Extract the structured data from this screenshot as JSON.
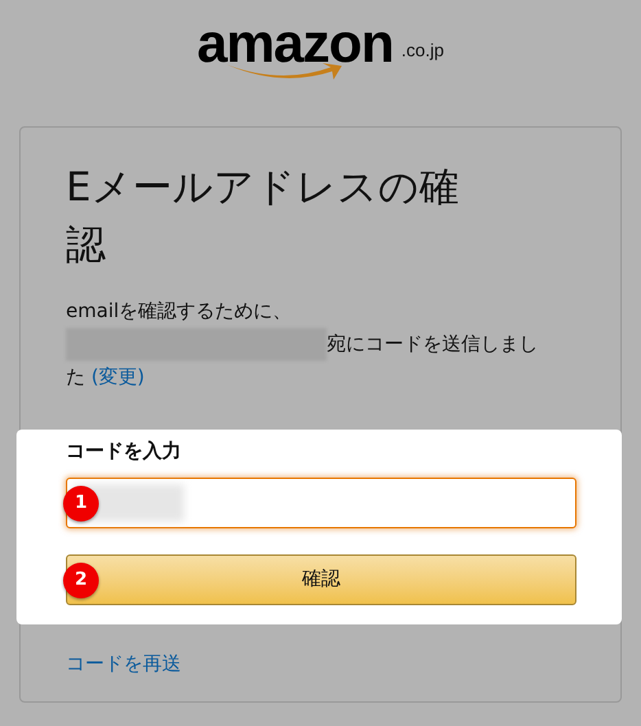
{
  "logo": {
    "wordmark": "amazon",
    "suffix": ".co.jp"
  },
  "title": "Eメールアドレスの確認",
  "message": {
    "before": "emailを確認するために、",
    "email_redacted": true,
    "after": "宛にコードを送信しました",
    "change_link": "(変更)"
  },
  "code_section": {
    "highlighted": true,
    "label": "コードを入力",
    "input": {
      "marker": "1",
      "focused": true,
      "value_redacted": true
    },
    "button": {
      "marker": "2",
      "label": "確認"
    }
  },
  "resend_link": "コードを再送"
}
